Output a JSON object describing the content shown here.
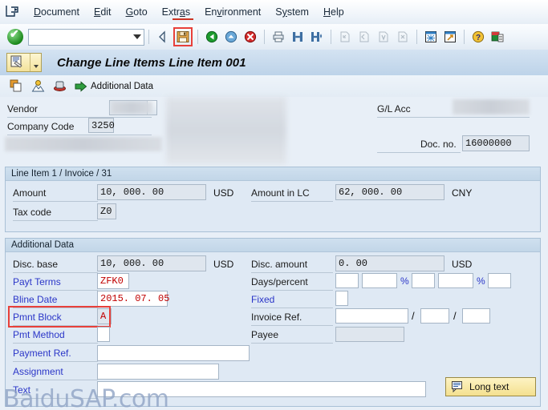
{
  "menu": {
    "system_icon": "system-menu-icon",
    "items": [
      {
        "label": "Document",
        "accel": "D"
      },
      {
        "label": "Edit",
        "accel": "E"
      },
      {
        "label": "Goto",
        "accel": "G"
      },
      {
        "label": "Extras",
        "accel": "a"
      },
      {
        "label": "Environment",
        "accel": "v"
      },
      {
        "label": "System",
        "accel": "y"
      },
      {
        "label": "Help",
        "accel": "H"
      }
    ]
  },
  "toolbar": {
    "enter_label": "enter-check-icon",
    "command_field_value": "",
    "command_field_placeholder": "",
    "buttons": [
      {
        "name": "back-icon",
        "title": "Back"
      },
      {
        "name": "save-icon",
        "title": "Save",
        "highlighted": true
      },
      {
        "name": "exit-icon",
        "title": "Exit"
      },
      {
        "name": "cancel-icon",
        "title": "Cancel"
      },
      {
        "name": "print-icon",
        "title": "Print"
      },
      {
        "name": "find-icon",
        "title": "Find"
      },
      {
        "name": "find-next-icon",
        "title": "Find Next"
      },
      {
        "name": "first-page-icon",
        "title": "First Page"
      },
      {
        "name": "previous-page-icon",
        "title": "Previous Page"
      },
      {
        "name": "next-page-icon",
        "title": "Next Page"
      },
      {
        "name": "last-page-icon",
        "title": "Last Page"
      },
      {
        "name": "create-session-icon",
        "title": "Create Session"
      },
      {
        "name": "create-shortcut-icon",
        "title": "Create Shortcut"
      },
      {
        "name": "help-icon",
        "title": "Help"
      },
      {
        "name": "customize-layout-icon",
        "title": "Customize Local Layout"
      }
    ]
  },
  "title": {
    "icon": "document-change-icon",
    "text": "Change Line Items Line Item 001"
  },
  "app_toolbar": {
    "buttons": [
      {
        "name": "copy-icon",
        "label": ""
      },
      {
        "name": "person-icon",
        "label": ""
      },
      {
        "name": "printer-icon",
        "label": ""
      },
      {
        "name": "additional-data-icon",
        "label": "Additional Data"
      }
    ]
  },
  "header": {
    "vendor_label": "Vendor",
    "vendor_value": "",
    "company_code_label": "Company Code",
    "company_code_value": "3250",
    "gl_acc_label": "G/L Acc",
    "gl_acc_value": "",
    "doc_no_label": "Doc. no.",
    "doc_no_value": "16000000"
  },
  "line_item": {
    "group_title": "Line Item 1 / Invoice / 31",
    "amount_label": "Amount",
    "amount_value": "10, 000. 00",
    "amount_currency": "USD",
    "amount_lc_label": "Amount in LC",
    "amount_lc_value": "62, 000. 00",
    "amount_lc_currency": "CNY",
    "tax_code_label": "Tax code",
    "tax_code_value": "Z0"
  },
  "additional_data": {
    "group_title": "Additional Data",
    "disc_base_label": "Disc. base",
    "disc_base_value": "10, 000. 00",
    "disc_base_currency": "USD",
    "disc_amount_label": "Disc. amount",
    "disc_amount_value": "0. 00",
    "disc_amount_currency": "USD",
    "payt_terms_label": "Payt Terms",
    "payt_terms_value": "ZFK0",
    "days_percent_label": "Days/percent",
    "days1": "",
    "pct1": "",
    "pct_sign1": "%",
    "days2": "",
    "pct2": "",
    "pct_sign2": "%",
    "days3": "",
    "bline_date_label": "Bline Date",
    "bline_date_value": "2015. 07. 05",
    "fixed_label": "Fixed",
    "fixed_value": "",
    "pmnt_block_label": "Pmnt Block",
    "pmnt_block_value": "A",
    "invoice_ref_label": "Invoice Ref.",
    "invoice_ref_1": "",
    "invoice_ref_2": "",
    "invoice_ref_3": "",
    "invoice_ref_sep": "/",
    "pmt_method_label": "Pmt Method",
    "pmt_method_value": "",
    "payee_label": "Payee",
    "payee_value": "",
    "payment_ref_label": "Payment Ref.",
    "payment_ref_value": "",
    "assignment_label": "Assignment",
    "assignment_value": "",
    "text_label": "Text",
    "text_value": "",
    "long_text_button": "Long text"
  },
  "watermark": {
    "text": "BaiduSAP.com"
  },
  "colors": {
    "accent_blue": "#2b36c8",
    "highlight_red": "#e8403a",
    "field_red_text": "#c00000",
    "group_bg": "#dfe9f4",
    "canvas_bg": "#e8eff7"
  }
}
